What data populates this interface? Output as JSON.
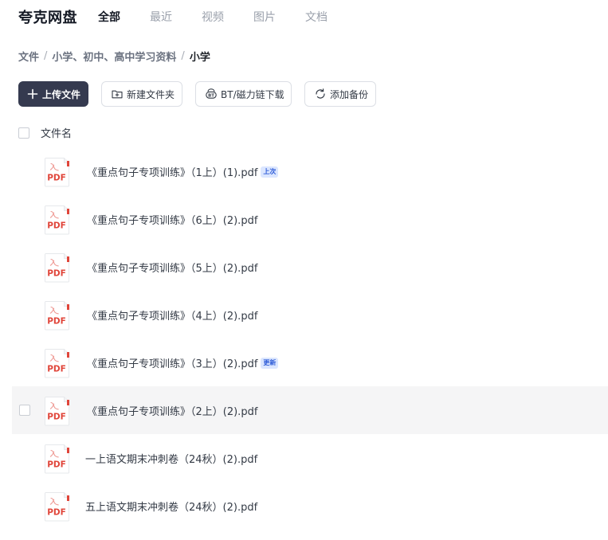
{
  "app": {
    "logo": "夸克网盘"
  },
  "nav": {
    "items": [
      {
        "label": "全部",
        "active": true
      },
      {
        "label": "最近",
        "active": false
      },
      {
        "label": "视频",
        "active": false
      },
      {
        "label": "图片",
        "active": false
      },
      {
        "label": "文档",
        "active": false
      }
    ]
  },
  "breadcrumb": {
    "items": [
      "文件",
      "小学、初中、高中学习资料",
      "小学"
    ],
    "separator": "/"
  },
  "toolbar": {
    "upload_label": "上传文件",
    "new_folder_label": "新建文件夹",
    "bt_label": "BT/磁力链下载",
    "backup_label": "添加备份"
  },
  "list": {
    "header_name": "文件名",
    "files": [
      {
        "name": "《重点句子专项训练》（1上）(1).pdf",
        "badge": "上次"
      },
      {
        "name": "《重点句子专项训练》（6上）(2).pdf",
        "badge": ""
      },
      {
        "name": "《重点句子专项训练》（5上）(2).pdf",
        "badge": ""
      },
      {
        "name": "《重点句子专项训练》（4上）(2).pdf",
        "badge": ""
      },
      {
        "name": "《重点句子专项训练》（3上）(2).pdf",
        "badge": "更新"
      },
      {
        "name": "《重点句子专项训练》（2上）(2).pdf",
        "badge": ""
      },
      {
        "name": "一上语文期末冲刺卷（24秋）(2).pdf",
        "badge": ""
      },
      {
        "name": "五上语文期末冲刺卷（24秋）(2).pdf",
        "badge": ""
      }
    ]
  },
  "icons": {
    "file_type": "pdf-file-icon",
    "file_type_label": "PDF"
  },
  "colors": {
    "primary_button": "#353a4f",
    "pdf_red": "#e0453a",
    "badge_bg": "#dbe6ff",
    "badge_text": "#2d5bd7"
  }
}
